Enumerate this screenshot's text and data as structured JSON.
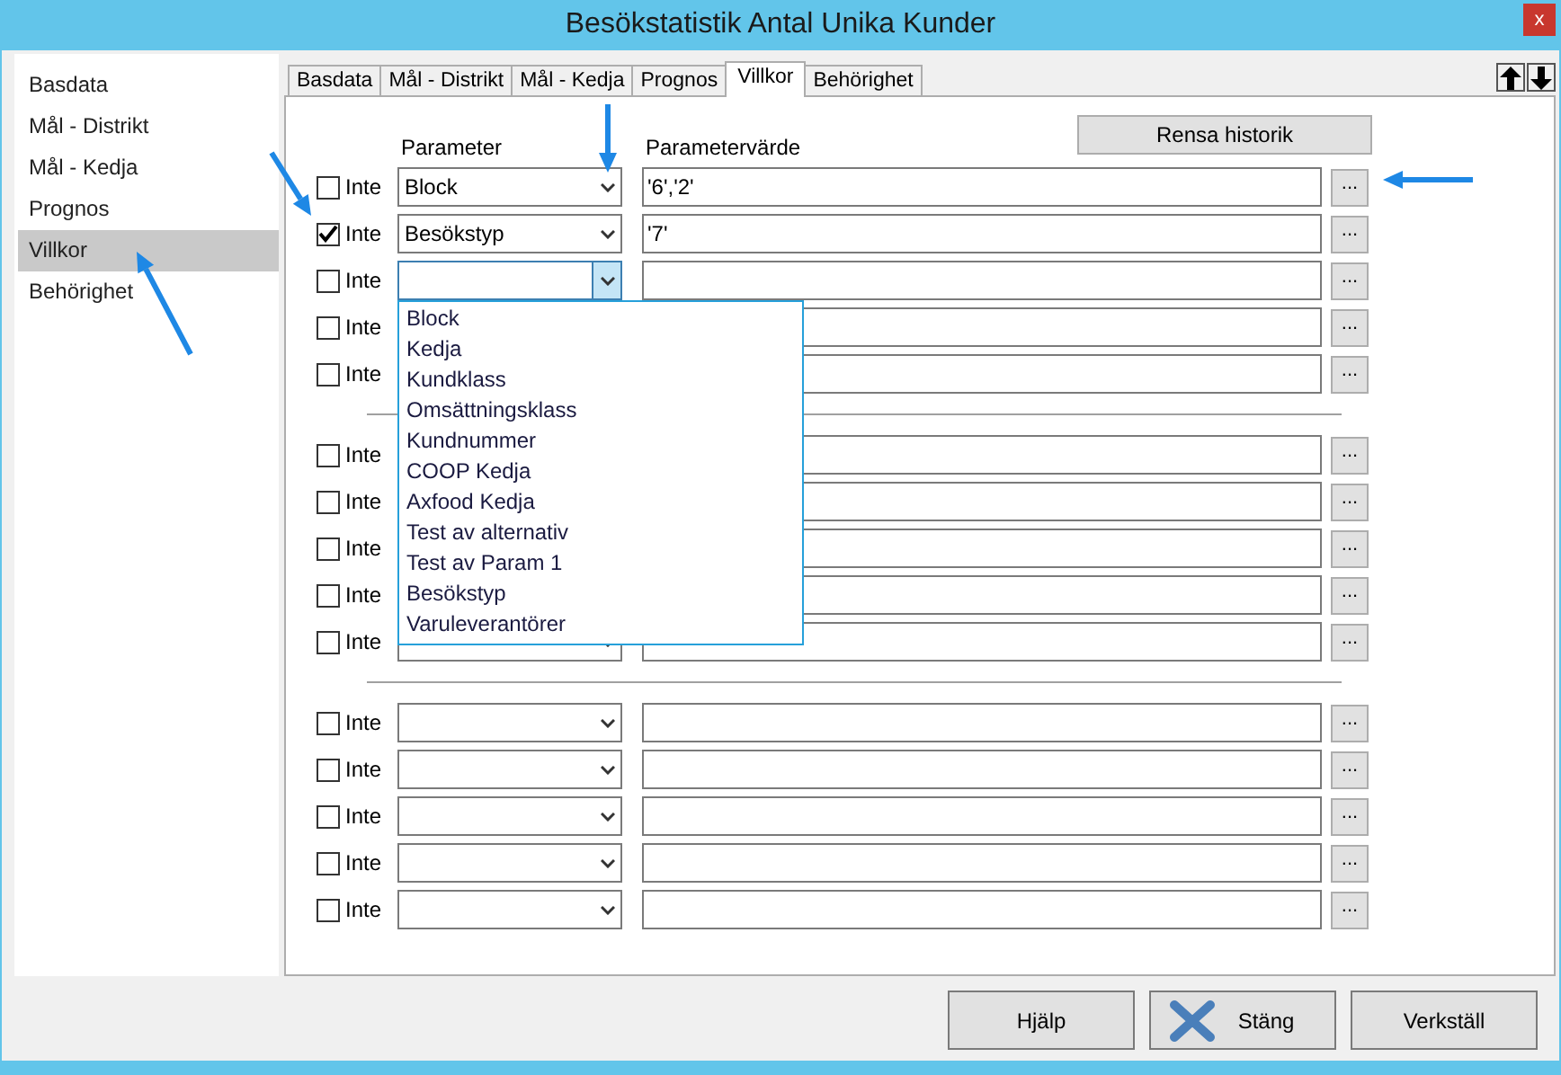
{
  "window": {
    "title": "Besökstatistik Antal Unika Kunder",
    "close": "x"
  },
  "sidebar": {
    "items": [
      {
        "label": "Basdata",
        "selected": false
      },
      {
        "label": "Mål - Distrikt",
        "selected": false
      },
      {
        "label": "Mål - Kedja",
        "selected": false
      },
      {
        "label": "Prognos",
        "selected": false
      },
      {
        "label": "Villkor",
        "selected": true
      },
      {
        "label": "Behörighet",
        "selected": false
      }
    ]
  },
  "tabs": [
    {
      "label": "Basdata",
      "selected": false
    },
    {
      "label": "Mål - Distrikt",
      "selected": false
    },
    {
      "label": "Mål - Kedja",
      "selected": false
    },
    {
      "label": "Prognos",
      "selected": false
    },
    {
      "label": "Villkor",
      "selected": true
    },
    {
      "label": "Behörighet",
      "selected": false
    }
  ],
  "panel": {
    "clear_history": "Rensa historik",
    "headers": {
      "parameter": "Parameter",
      "value": "Parametervärde"
    },
    "groups": [
      {
        "rows": [
          {
            "label": "Inte",
            "checked": false,
            "parameter": "Block",
            "value": "'6','2'",
            "browse": "...",
            "open": false
          },
          {
            "label": "Inte",
            "checked": true,
            "parameter": "Besökstyp",
            "value": "'7'",
            "browse": "...",
            "open": false
          },
          {
            "label": "Inte",
            "checked": false,
            "browse": "...",
            "open": true
          },
          {
            "label": "Inte",
            "checked": false,
            "browse": "...",
            "open": false
          },
          {
            "label": "Inte",
            "checked": false,
            "browse": "...",
            "open": false
          }
        ]
      },
      {
        "rows": [
          {
            "label": "Inte",
            "checked": false,
            "browse": "...",
            "open": false
          },
          {
            "label": "Inte",
            "checked": false,
            "browse": "...",
            "open": false
          },
          {
            "label": "Inte",
            "checked": false,
            "browse": "...",
            "open": false
          },
          {
            "label": "Inte",
            "checked": false,
            "browse": "...",
            "open": false
          },
          {
            "label": "Inte",
            "checked": false,
            "browse": "...",
            "open": false
          }
        ]
      },
      {
        "rows": [
          {
            "label": "Inte",
            "checked": false,
            "browse": "...",
            "open": false
          },
          {
            "label": "Inte",
            "checked": false,
            "browse": "...",
            "open": false
          },
          {
            "label": "Inte",
            "checked": false,
            "browse": "...",
            "open": false
          },
          {
            "label": "Inte",
            "checked": false,
            "browse": "...",
            "open": false
          },
          {
            "label": "Inte",
            "checked": false,
            "browse": "...",
            "open": false
          }
        ]
      }
    ],
    "dropdown_options": [
      "Block",
      "Kedja",
      "Kundklass",
      "Omsättningsklass",
      "Kundnummer",
      "COOP Kedja",
      "Axfood Kedja",
      "Test av alternativ",
      "Test av Param 1",
      "Besökstyp",
      "Varuleverantörer"
    ]
  },
  "buttons": [
    {
      "label": "Hjälp",
      "kind": "plain"
    },
    {
      "label": "Stäng",
      "kind": "close"
    },
    {
      "label": "Verkställ",
      "kind": "plain"
    }
  ]
}
